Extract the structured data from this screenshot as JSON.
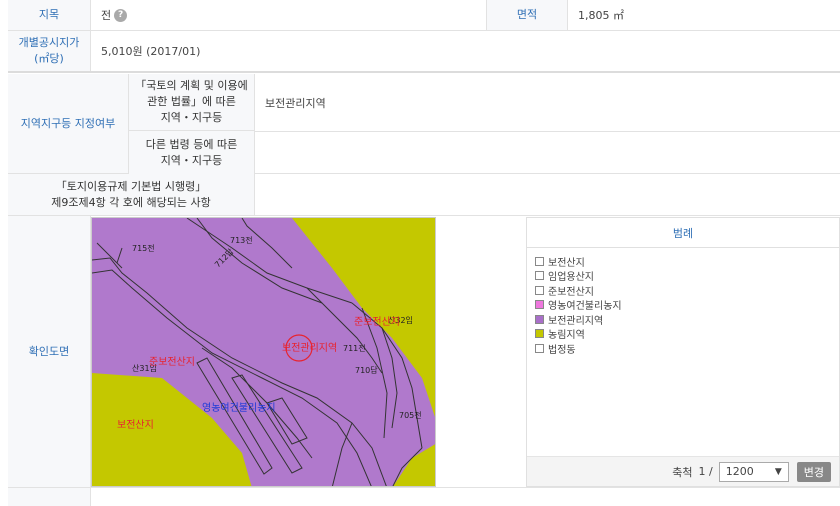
{
  "land": {
    "category_label": "지목",
    "category_value": "전",
    "area_label": "면적",
    "area_value": "1,805 ㎡",
    "price_label": "개별공시지가(㎡당)",
    "price_value": "5,010원 (2017/01)"
  },
  "zoning": {
    "header": "지역지구등 지정여부",
    "law1_label_line1": "「국토의 계획 및 이용에",
    "law1_label_line2": "관한 법률」에 따른",
    "law1_label_line3": "지역・지구등",
    "law1_value": "보전관리지역",
    "law2_label_line1": "다른 법령 등에 따른",
    "law2_label_line2": "지역・지구등",
    "law2_value": "",
    "enforcement_line1": "「토지이용규제 기본법 시행령」",
    "enforcement_line2": "제9조제4항 각 호에 해당되는 사항",
    "enforcement_value": ""
  },
  "map_section": {
    "header": "확인도면",
    "labels": {
      "parcel_715": "715전",
      "parcel_713": "713전",
      "parcel_712": "712답",
      "parcel_711": "711전",
      "parcel_710": "710답",
      "parcel_705": "705전",
      "parcel_san31": "산31임",
      "parcel_san32": "산32임",
      "zone_conservation_mgmt": "보전관리지역",
      "zone_semi_conservation_mountain_left": "준보전산지",
      "zone_semi_conservation_mountain_right": "준보전산지",
      "zone_conservation_mountain": "보전산지",
      "zone_fishing_village": "영농여건불리농지"
    }
  },
  "legend": {
    "title": "범례",
    "items": [
      {
        "label": "보전산지",
        "color": "#ffffff"
      },
      {
        "label": "임업용산지",
        "color": "#ffffff"
      },
      {
        "label": "준보전산지",
        "color": "#ffffff"
      },
      {
        "label": "영농여건불리농지",
        "color": "#ee77dd"
      },
      {
        "label": "보전관리지역",
        "color": "#a96fc9"
      },
      {
        "label": "농림지역",
        "color": "#c4c800"
      },
      {
        "label": "법정동",
        "color": "#ffffff"
      }
    ],
    "scale_label": "축척",
    "scale_prefix": "1 /",
    "scale_value": "1200",
    "change_button": "변경"
  },
  "colors": {
    "purple": "#b079cc",
    "yellow": "#c4c800",
    "accent_blue": "#2f6fb5"
  }
}
